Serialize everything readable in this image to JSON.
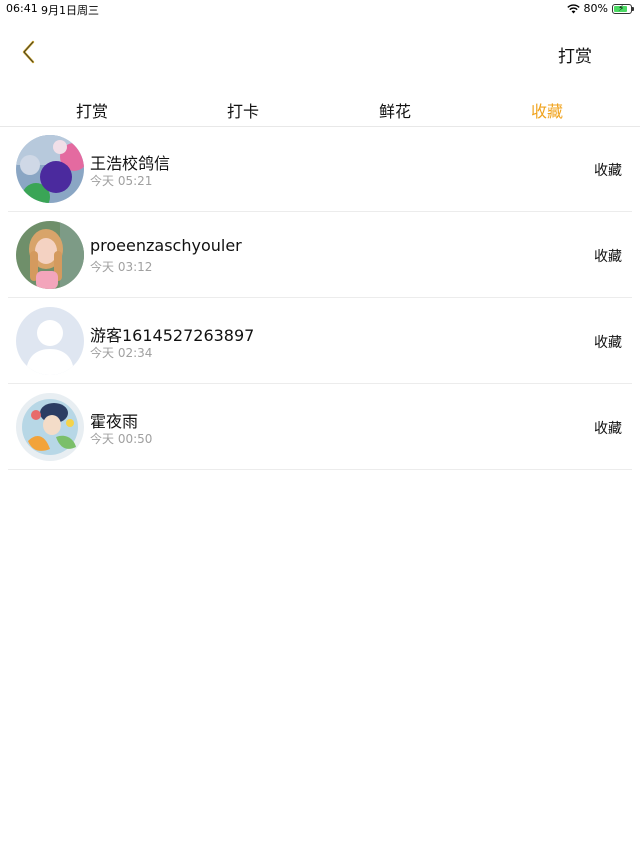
{
  "status_bar": {
    "time": "06:41",
    "date": "9月1日周三",
    "battery_percent": "80%",
    "battery_level": 0.8,
    "wifi_icon": "wifi-icon",
    "battery_icon": "battery-charging-icon"
  },
  "nav": {
    "back_icon": "chevron-left-icon",
    "back_icon_color": "#c9a227",
    "action_label": "打赏"
  },
  "tabs": [
    {
      "label": "打赏",
      "active": false
    },
    {
      "label": "打卡",
      "active": false
    },
    {
      "label": "鲜花",
      "active": false
    },
    {
      "label": "收藏",
      "active": true
    }
  ],
  "accent_color": "#f0a31e",
  "items": [
    {
      "name": "王浩校鸽信",
      "time": "今天 05:21",
      "action": "收藏",
      "avatar": "avatar-colorful-balls"
    },
    {
      "name": "proeenzaschyouler",
      "time": "今天 03:12",
      "action": "收藏",
      "avatar": "avatar-girl-photo"
    },
    {
      "name": "游客1614527263897",
      "time": "今天 02:34",
      "action": "收藏",
      "avatar": "avatar-default-silhouette"
    },
    {
      "name": "霍夜雨",
      "time": "今天 00:50",
      "action": "收藏",
      "avatar": "avatar-anime-illustration"
    }
  ]
}
